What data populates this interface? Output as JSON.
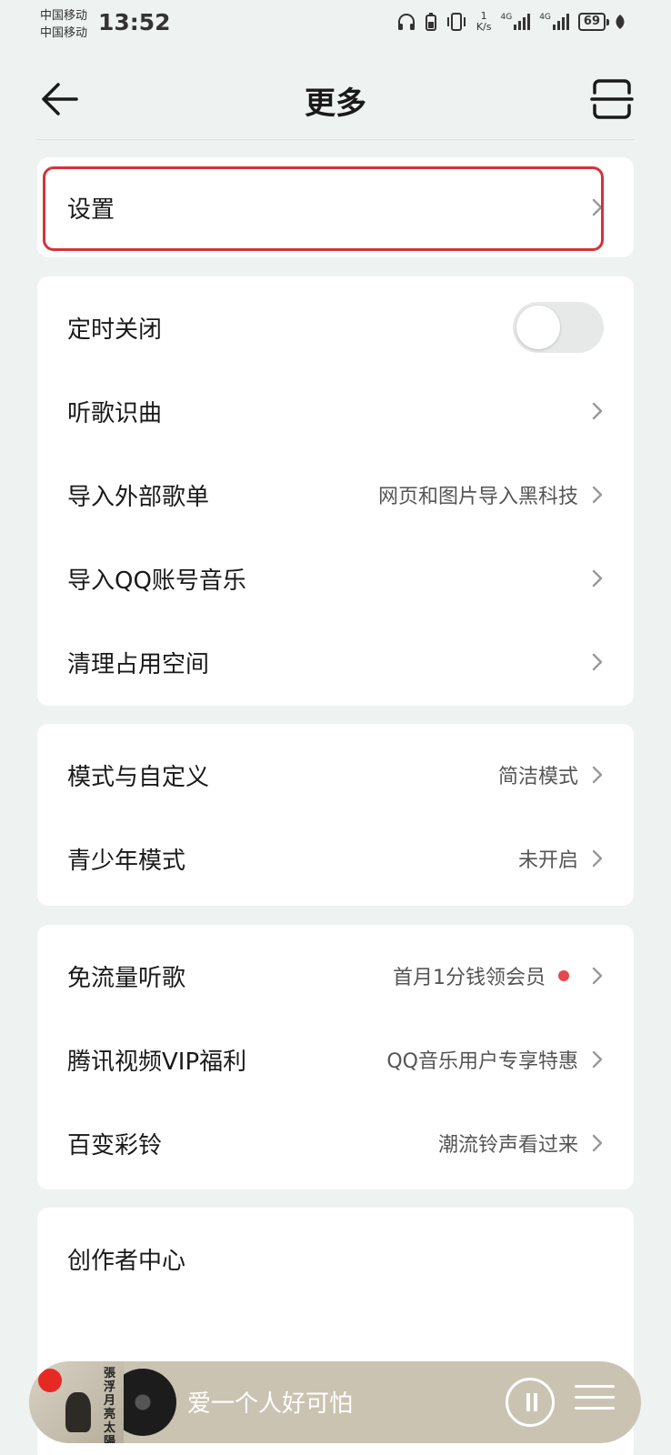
{
  "status_bar": {
    "carrier_1": "中国移动",
    "carrier_2": "中国移动",
    "time": "13:52",
    "net_speed_value": "1",
    "net_speed_unit": "K/s",
    "signal_1": "4G",
    "signal_2": "4G",
    "battery": "69"
  },
  "header": {
    "title": "更多",
    "back_icon": "arrow-left-icon",
    "scan_icon": "scan-icon"
  },
  "sections": {
    "settings": {
      "label": "设置",
      "highlight_color": "#d6323a"
    },
    "tools": {
      "sleep_timer": {
        "label": "定时关闭",
        "enabled": false
      },
      "song_recognition": {
        "label": "听歌识曲"
      },
      "import_playlist": {
        "label": "导入外部歌单",
        "value": "网页和图片导入黑科技"
      },
      "import_qq": {
        "label": "导入QQ账号音乐"
      },
      "clean_space": {
        "label": "清理占用空间"
      }
    },
    "modes": {
      "mode_custom": {
        "label": "模式与自定义",
        "value": "简洁模式"
      },
      "teen_mode": {
        "label": "青少年模式",
        "value": "未开启"
      }
    },
    "benefits": {
      "free_data": {
        "label": "免流量听歌",
        "value": "首月1分钱领会员",
        "dot_color": "#e8474c"
      },
      "tencent_video": {
        "label": "腾讯视频VIP福利",
        "value": "QQ音乐用户专享特惠"
      },
      "ringtone": {
        "label": "百变彩铃",
        "value": "潮流铃声看过来"
      }
    },
    "creator": {
      "creator_center": {
        "label": "创作者中心"
      }
    }
  },
  "mini_player": {
    "song_title": "爱一个人好可怕",
    "cover_text": "張浮 月亮 太陽",
    "background_color": "#cbc3b2"
  }
}
